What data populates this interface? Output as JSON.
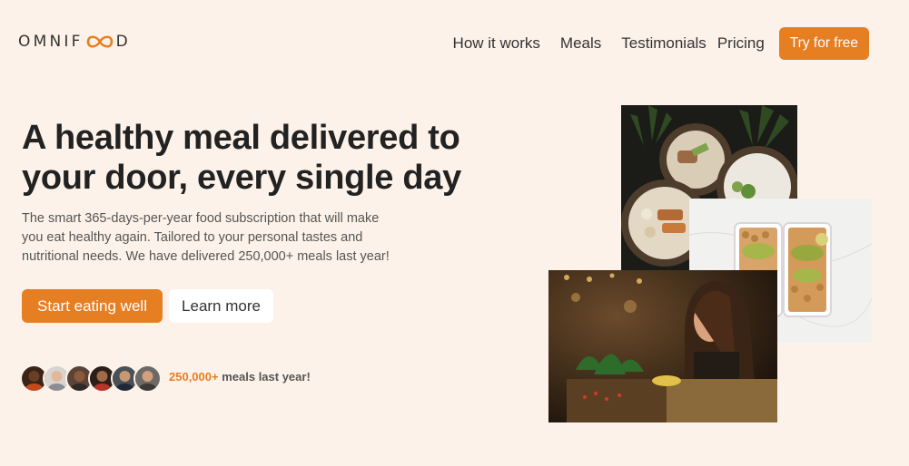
{
  "header": {
    "logo_prefix": "OMNIF",
    "logo_suffix": "D",
    "nav": {
      "how_it_works": "How it works",
      "meals": "Meals",
      "testimonials": "Testimonials",
      "pricing": "Pricing",
      "cta": "Try for free"
    }
  },
  "hero": {
    "title_line1": "A healthy meal delivered to",
    "title_line2": "your door, every single day",
    "description": "The smart 365-days-per-year food subscription that will make you eat healthy again. Tailored to your personal tastes and nutritional needs. We have delivered 250,000+ meals last year!",
    "primary_button": "Start eating well",
    "secondary_button": "Learn more"
  },
  "delivered": {
    "count": "250,000+",
    "text": "meals last year!"
  },
  "colors": {
    "background": "#fdf2e9",
    "accent": "#e67e22",
    "text": "#333333"
  }
}
